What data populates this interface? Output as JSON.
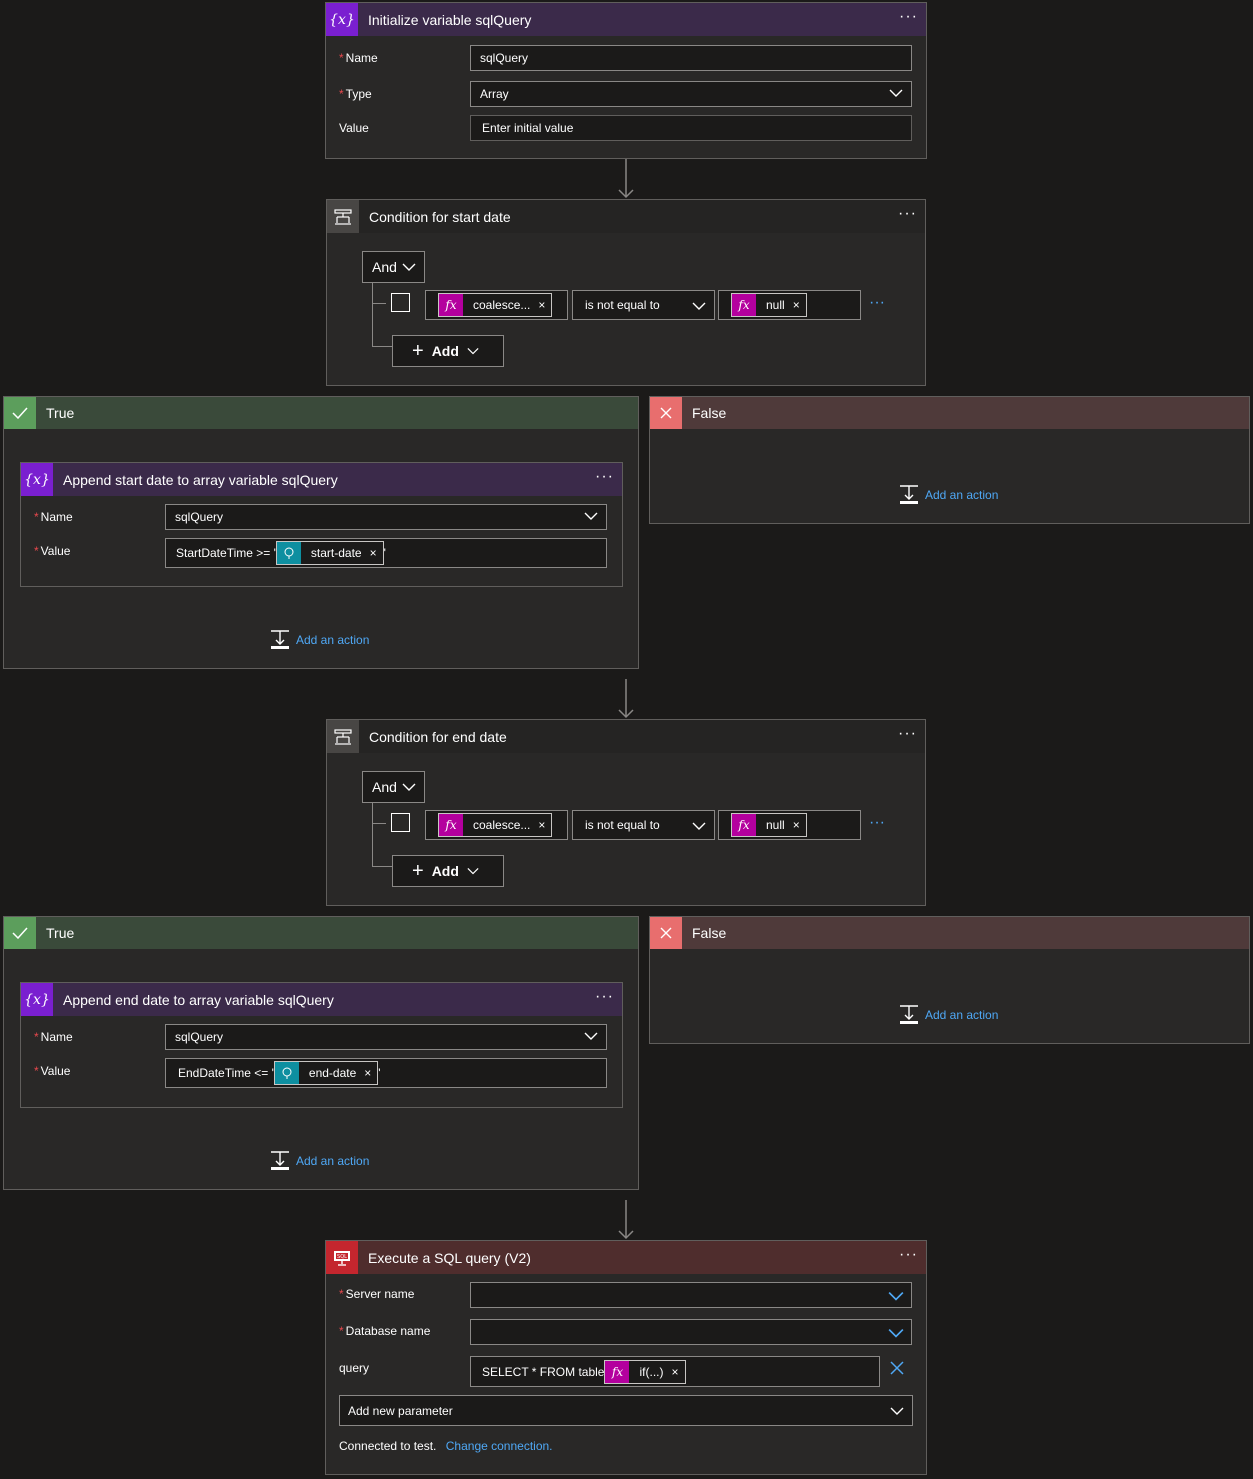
{
  "init_var": {
    "title": "Initialize variable sqlQuery",
    "icon": "variable-icon",
    "color": "#5a2a8a",
    "name_label": "Name",
    "name_value": "sqlQuery",
    "type_label": "Type",
    "type_value": "Array",
    "value_label": "Value",
    "value_placeholder": "Enter initial value"
  },
  "cond1": {
    "title": "Condition for start date",
    "and_label": "And",
    "left_token": "coalesce...",
    "operator": "is not equal to",
    "right_token": "null",
    "add_label": "Add"
  },
  "branch1_true": {
    "title": "True",
    "action": {
      "title": "Append start date to array variable sqlQuery",
      "name_label": "Name",
      "name_value": "sqlQuery",
      "value_label": "Value",
      "value_prefix": "StartDateTime >= '",
      "token": "start-date",
      "value_suffix": "'"
    },
    "add_action": "Add an action"
  },
  "branch1_false": {
    "title": "False",
    "add_action": "Add an action"
  },
  "cond2": {
    "title": "Condition for end date",
    "and_label": "And",
    "left_token": "coalesce...",
    "operator": "is not equal to",
    "right_token": "null",
    "add_label": "Add"
  },
  "branch2_true": {
    "title": "True",
    "action": {
      "title": "Append end date to array variable sqlQuery",
      "name_label": "Name",
      "name_value": "sqlQuery",
      "value_label": "Value",
      "value_prefix": "EndDateTime <= '",
      "token": "end-date",
      "value_suffix": "'"
    },
    "add_action": "Add an action"
  },
  "branch2_false": {
    "title": "False",
    "add_action": "Add an action"
  },
  "sql": {
    "title": "Execute a SQL query (V2)",
    "color": "#c4262e",
    "server_label": "Server name",
    "database_label": "Database name",
    "query_label": "query",
    "query_prefix": "SELECT * FROM table",
    "query_token": "if(...)",
    "add_param": "Add new parameter",
    "connected_text": "Connected to test.",
    "change_link": "Change connection."
  },
  "colors": {
    "true_header": "#3a4a3a",
    "false_header": "#4f3a3a",
    "link": "#4fa8f5",
    "variable_purple": "#7a1fd0",
    "fx_magenta": "#b4009e",
    "token_teal": "#0e8fa0"
  }
}
